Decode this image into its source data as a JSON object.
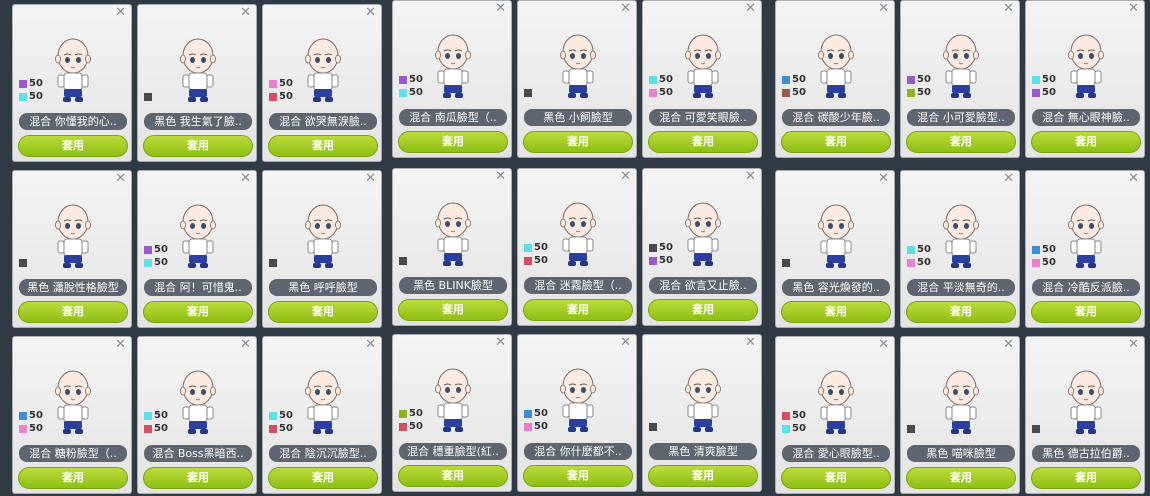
{
  "colors": {
    "purple": "#9b59d0",
    "cyan": "#5ce0ea",
    "pink": "#f07ccc",
    "darkgray": "#4a4a4a",
    "blue": "#3b8fd4",
    "brown": "#9b5e46",
    "olive": "#8fb414",
    "red": "#d84c64"
  },
  "cards": [
    {
      "name": "混合 你懂我的心..",
      "button": "套用",
      "swatches": [
        {
          "color": "purple",
          "value": "50"
        },
        {
          "color": "cyan",
          "value": "50"
        }
      ]
    },
    {
      "name": "黑色 我生氣了臉..",
      "button": "套用",
      "swatches": [
        {
          "color": "darkgray",
          "value": ""
        }
      ]
    },
    {
      "name": "混合 欲哭無淚臉..",
      "button": "套用",
      "swatches": [
        {
          "color": "pink",
          "value": "50"
        },
        {
          "color": "red",
          "value": "50"
        }
      ]
    },
    {
      "name": "混合 南瓜臉型（..",
      "button": "套用",
      "swatches": [
        {
          "color": "purple",
          "value": "50"
        },
        {
          "color": "cyan",
          "value": "50"
        }
      ]
    },
    {
      "name": "黑色 小飼臉型",
      "button": "套用",
      "swatches": [
        {
          "color": "darkgray",
          "value": ""
        }
      ]
    },
    {
      "name": "混合 可愛笑眼臉..",
      "button": "套用",
      "swatches": [
        {
          "color": "cyan",
          "value": "50"
        },
        {
          "color": "pink",
          "value": "50"
        }
      ]
    },
    {
      "name": "混合 碳酸少年臉..",
      "button": "套用",
      "swatches": [
        {
          "color": "blue",
          "value": "50"
        },
        {
          "color": "brown",
          "value": "50"
        }
      ]
    },
    {
      "name": "混合 小可愛臉型..",
      "button": "套用",
      "swatches": [
        {
          "color": "purple",
          "value": "50"
        },
        {
          "color": "olive",
          "value": "50"
        }
      ]
    },
    {
      "name": "混合 無心眼神臉..",
      "button": "套用",
      "swatches": [
        {
          "color": "cyan",
          "value": "50"
        },
        {
          "color": "purple",
          "value": "50"
        }
      ]
    },
    {
      "name": "黑色 瀟脫性格臉型",
      "button": "套用",
      "swatches": [
        {
          "color": "darkgray",
          "value": ""
        }
      ]
    },
    {
      "name": "混合 阿！可惜鬼..",
      "button": "套用",
      "swatches": [
        {
          "color": "purple",
          "value": "50"
        },
        {
          "color": "cyan",
          "value": "50"
        }
      ]
    },
    {
      "name": "黑色 呼呼臉型",
      "button": "套用",
      "swatches": [
        {
          "color": "darkgray",
          "value": ""
        }
      ]
    },
    {
      "name": "黑色 BLINK臉型",
      "button": "套用",
      "swatches": [
        {
          "color": "darkgray",
          "value": ""
        }
      ]
    },
    {
      "name": "混合 迷霧臉型（..",
      "button": "套用",
      "swatches": [
        {
          "color": "cyan",
          "value": "50"
        },
        {
          "color": "red",
          "value": "50"
        }
      ]
    },
    {
      "name": "混合 欲言又止臉..",
      "button": "套用",
      "swatches": [
        {
          "color": "darkgray",
          "value": "50"
        },
        {
          "color": "purple",
          "value": "50"
        }
      ]
    },
    {
      "name": "黑色 容光煥發的..",
      "button": "套用",
      "swatches": [
        {
          "color": "darkgray",
          "value": ""
        }
      ]
    },
    {
      "name": "混合 平淡無奇的..",
      "button": "套用",
      "swatches": [
        {
          "color": "cyan",
          "value": "50"
        },
        {
          "color": "pink",
          "value": "50"
        }
      ]
    },
    {
      "name": "混合 冷酷反派臉..",
      "button": "套用",
      "swatches": [
        {
          "color": "blue",
          "value": "50"
        },
        {
          "color": "pink",
          "value": "50"
        }
      ]
    },
    {
      "name": "混合 糖粉臉型（..",
      "button": "套用",
      "swatches": [
        {
          "color": "blue",
          "value": "50"
        },
        {
          "color": "pink",
          "value": "50"
        }
      ]
    },
    {
      "name": "混合 Boss黑暗西..",
      "button": "套用",
      "swatches": [
        {
          "color": "cyan",
          "value": "50"
        },
        {
          "color": "red",
          "value": "50"
        }
      ]
    },
    {
      "name": "混合 陰沉沉臉型..",
      "button": "套用",
      "swatches": [
        {
          "color": "cyan",
          "value": "50"
        },
        {
          "color": "red",
          "value": "50"
        }
      ]
    },
    {
      "name": "混合 穩重臉型(紅..",
      "button": "套用",
      "swatches": [
        {
          "color": "olive",
          "value": "50"
        },
        {
          "color": "red",
          "value": "50"
        }
      ]
    },
    {
      "name": "混合 你什麼都不..",
      "button": "套用",
      "swatches": [
        {
          "color": "blue",
          "value": "50"
        },
        {
          "color": "pink",
          "value": "50"
        }
      ]
    },
    {
      "name": "黑色 清爽臉型",
      "button": "套用",
      "swatches": [
        {
          "color": "darkgray",
          "value": ""
        }
      ]
    },
    {
      "name": "混合 愛心眼臉型..",
      "button": "套用",
      "swatches": [
        {
          "color": "red",
          "value": "50"
        },
        {
          "color": "cyan",
          "value": "50"
        }
      ]
    },
    {
      "name": "黑色 喵咪臉型",
      "button": "套用",
      "swatches": [
        {
          "color": "darkgray",
          "value": ""
        }
      ]
    },
    {
      "name": "黑色 德古拉伯爵..",
      "button": "套用",
      "swatches": [
        {
          "color": "darkgray",
          "value": ""
        }
      ]
    }
  ]
}
